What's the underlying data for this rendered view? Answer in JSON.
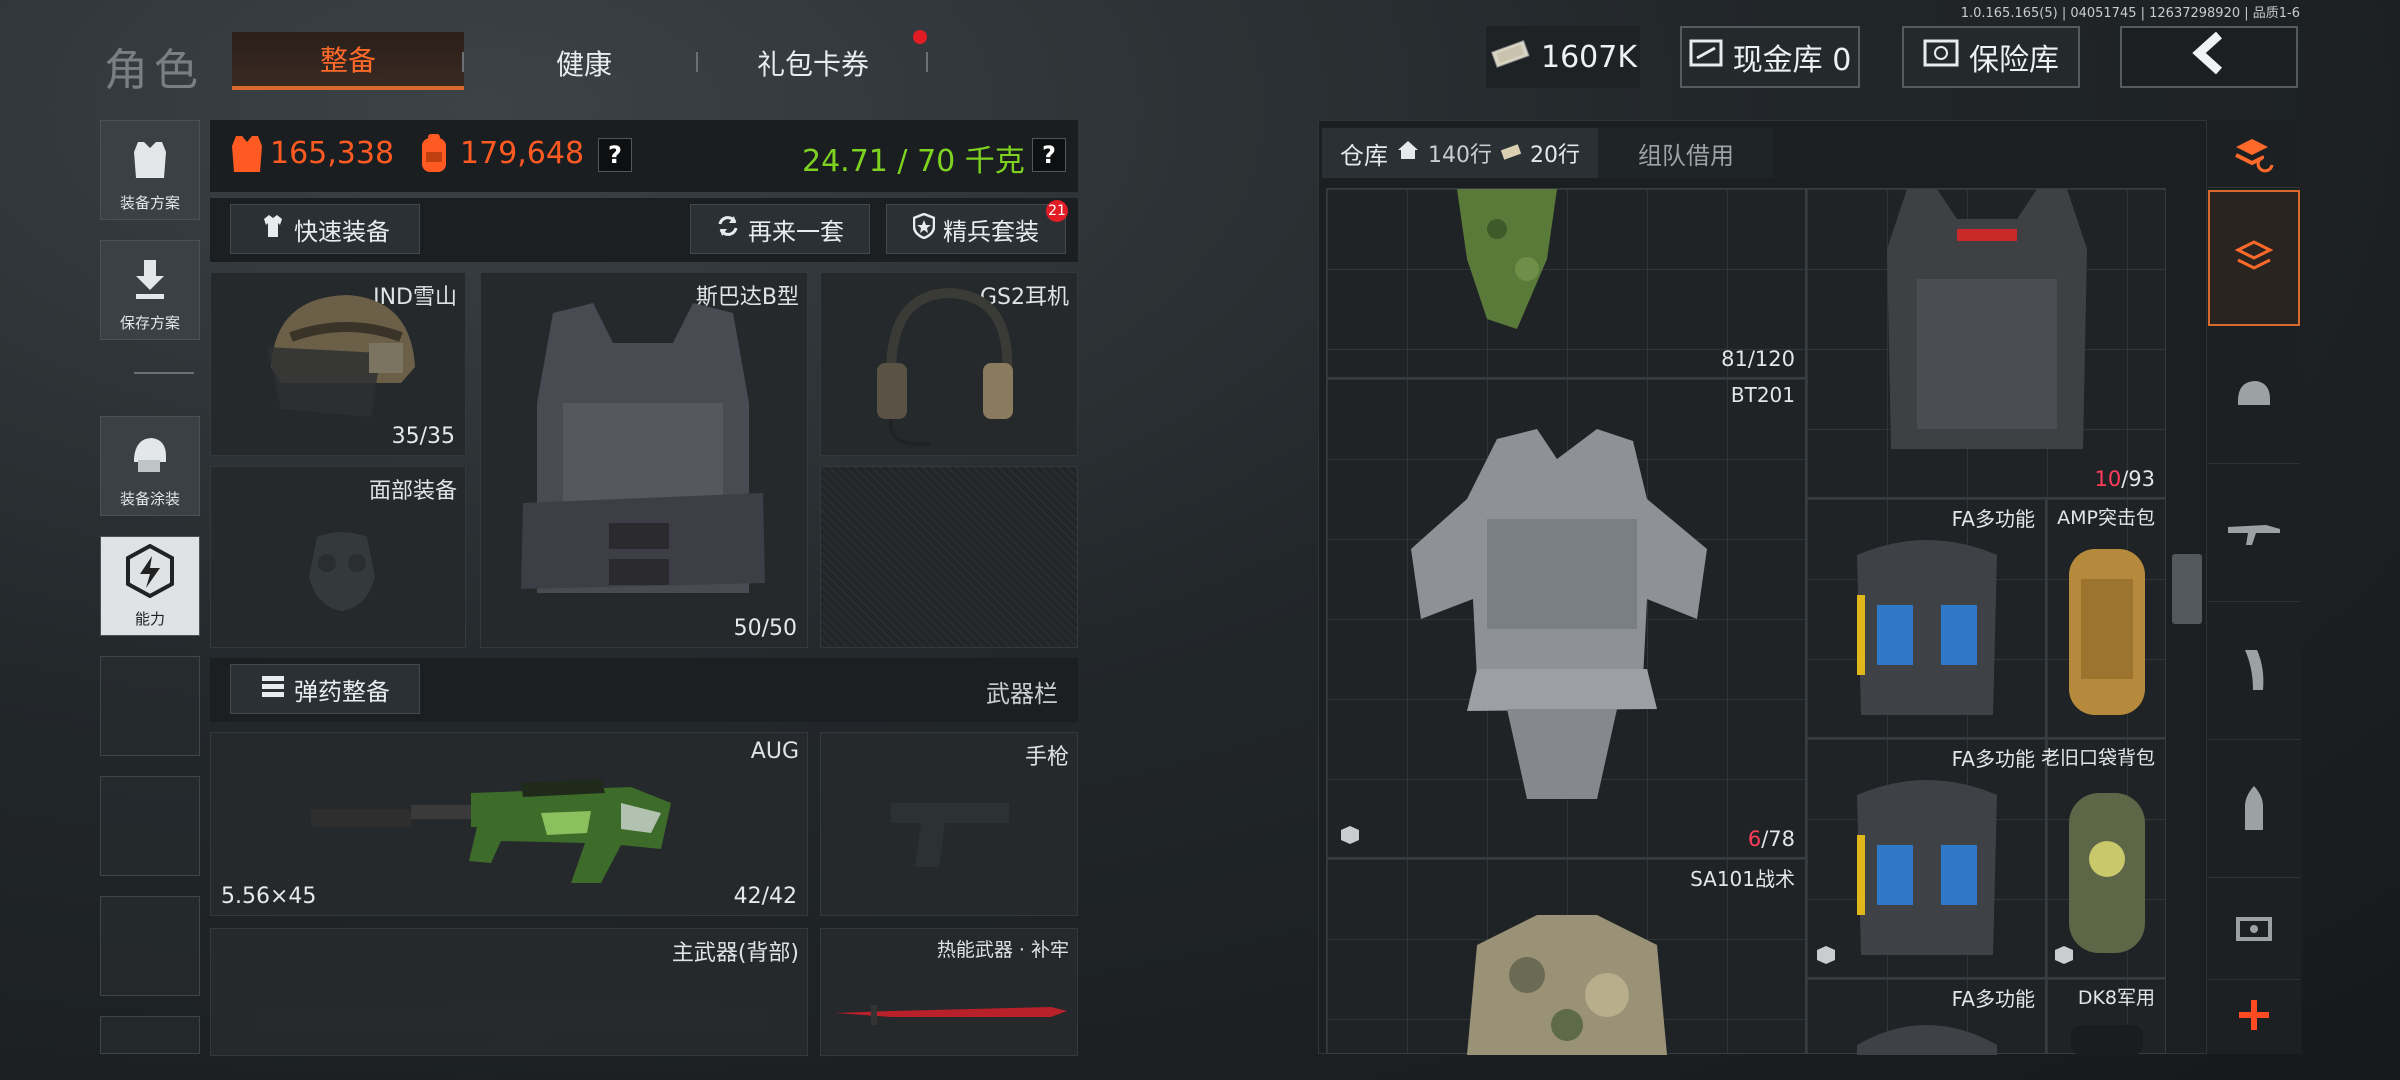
{
  "version": "1.0.165.165(5) | 04051745 | 12637298920 | 品质1-6",
  "header": {
    "title": "角色",
    "tabs": [
      {
        "label": "整备",
        "active": true
      },
      {
        "label": "健康",
        "active": false
      },
      {
        "label": "礼包卡券",
        "active": false,
        "notification": true
      }
    ],
    "money": "1607K",
    "cash_vault": "现金库 0",
    "insurance": "保险库"
  },
  "sidebar": {
    "items": [
      {
        "label": "装备方案",
        "icon": "vest-icon"
      },
      {
        "label": "保存方案",
        "icon": "download-icon"
      },
      {
        "label": "装备涂装",
        "icon": "helmet-paint-icon"
      },
      {
        "label": "能力",
        "icon": "ability-icon",
        "active": true
      }
    ]
  },
  "stats": {
    "armor_value": "165,338",
    "backpack_value": "179,648",
    "weight": "24.71 / 70 千克"
  },
  "gear_bar": {
    "quick_equip": "快速装备",
    "again": "再来一套",
    "elite_set": "精兵套装",
    "elite_badge": "21"
  },
  "gear_slots": {
    "helmet": {
      "label": "IND雪山",
      "count": "35/35"
    },
    "armor": {
      "label": "斯巴达B型",
      "count": "50/50"
    },
    "headset": {
      "label": "GS2耳机"
    },
    "face": {
      "label": "面部装备"
    }
  },
  "ammo_bar": {
    "ammo_equip": "弹药整备",
    "weapon_slot_label": "武器栏"
  },
  "weapons": {
    "primary": {
      "label": "AUG",
      "caliber": "5.56×45",
      "count": "42/42"
    },
    "pistol": {
      "label": "手枪"
    },
    "back_primary": {
      "label": "主武器(背部)"
    },
    "melee": {
      "label": "热能武器 · 补牢"
    }
  },
  "warehouse": {
    "tab_label": "仓库",
    "rows_home": "140行",
    "rows_ticket": "20行",
    "team_borrow": "组队借用",
    "items": [
      {
        "name": "",
        "count": "81/120"
      },
      {
        "name": "BT201",
        "count_red": "6",
        "count_rest": "/78"
      },
      {
        "name": "SA101战术",
        "count": ""
      },
      {
        "name": "",
        "count_red": "10",
        "count_rest": "/93"
      },
      {
        "name": "FA多功能"
      },
      {
        "name": "AMP突击包"
      },
      {
        "name": "FA多功能"
      },
      {
        "name": "老旧口袋背包"
      },
      {
        "name": "FA多功能"
      },
      {
        "name": "DK8军用"
      }
    ]
  },
  "colors": {
    "accent_orange": "#d96a2c",
    "value_orange": "#ff5a22",
    "weight_green": "#7ed321",
    "alert_red": "#ff3c5a"
  }
}
